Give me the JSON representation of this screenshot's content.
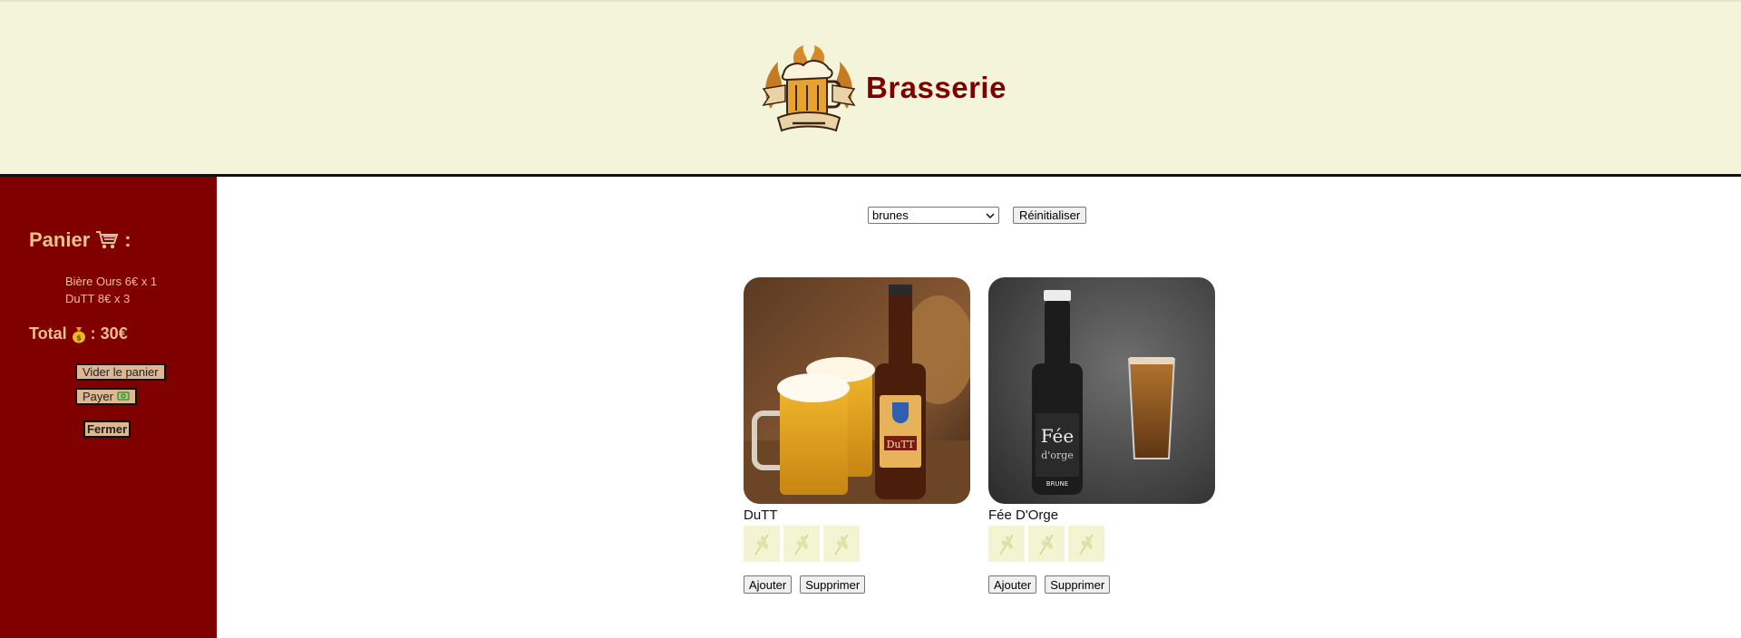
{
  "header": {
    "brand": "Brasserie",
    "logo_icon": "beer-mug-logo"
  },
  "cart": {
    "title": "Panier",
    "title_suffix": ":",
    "items": [
      "Bière Ours 6€ x 1",
      "DuTT 8€ x 3"
    ],
    "total_label": "Total",
    "total_value": ": 30€",
    "empty_label": "Vider le panier",
    "pay_label": "Payer",
    "close_label": "Fermer"
  },
  "filter": {
    "selected": "brunes",
    "reset_label": "Réinitialiser"
  },
  "products": [
    {
      "name": "DuTT",
      "add_label": "Ajouter",
      "remove_label": "Supprimer",
      "wheat_count": 3
    },
    {
      "name": "Fée D'Orge",
      "add_label": "Ajouter",
      "remove_label": "Supprimer",
      "wheat_count": 3
    }
  ],
  "colors": {
    "accent": "#800000",
    "header_bg": "#f4f4da",
    "cart_text": "#f0c08a"
  }
}
